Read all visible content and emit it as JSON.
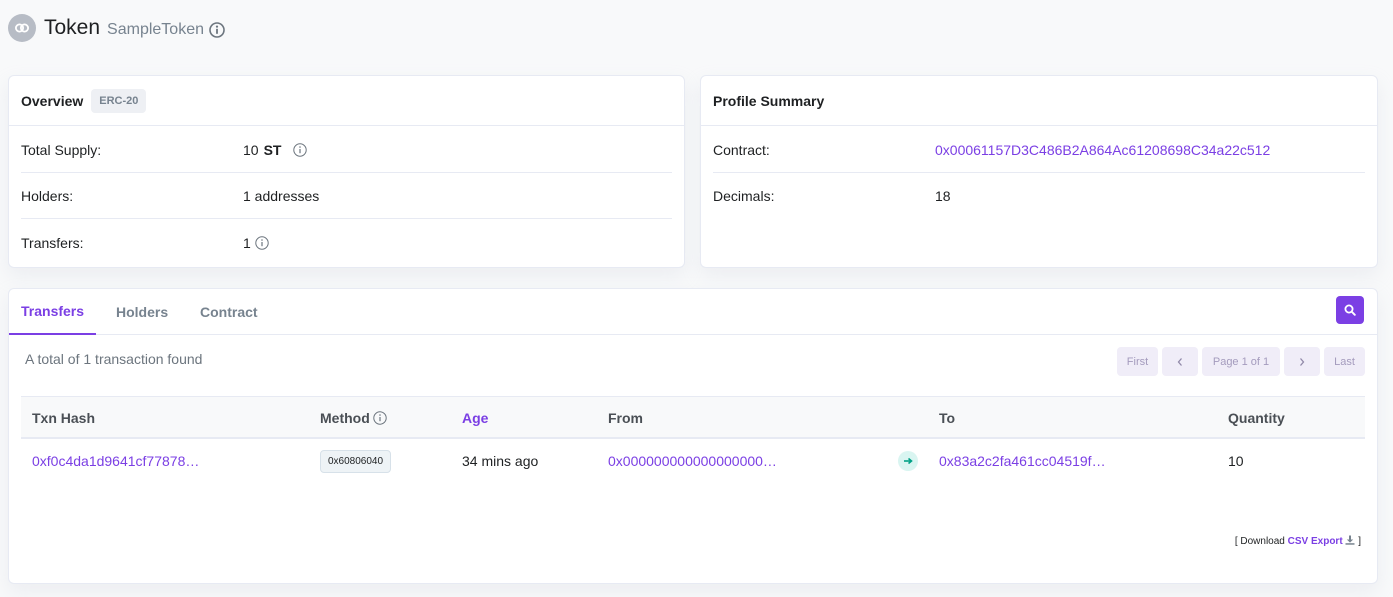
{
  "header": {
    "title": "Token",
    "subtitle": "SampleToken",
    "logo_icon": "link-icon",
    "info_icon": "info-circle-icon"
  },
  "overview": {
    "title": "Overview",
    "badge": "ERC-20",
    "rows": [
      {
        "label": "Total Supply:",
        "value": "10",
        "unit": "ST"
      },
      {
        "label": "Holders:",
        "value": "1 addresses"
      },
      {
        "label": "Transfers:",
        "value": "1"
      }
    ]
  },
  "profile": {
    "title": "Profile Summary",
    "rows": [
      {
        "label": "Contract:",
        "value": "0x00061157D3C486B2A864Ac61208698C34a22c512"
      },
      {
        "label": "Decimals:",
        "value": "18"
      }
    ]
  },
  "tabs": [
    {
      "label": "Transfers",
      "active": true
    },
    {
      "label": "Holders",
      "active": false
    },
    {
      "label": "Contract",
      "active": false
    }
  ],
  "transfers": {
    "summary": "A total of 1 transaction found",
    "pager": {
      "first": "First",
      "prev": "‹",
      "page": "Page 1 of 1",
      "next": "›",
      "last": "Last"
    },
    "columns": [
      "Txn Hash",
      "Method",
      "Age",
      "From",
      "To",
      "Quantity"
    ],
    "rows": [
      {
        "txn_hash": "0xf0c4da1d9641cf77878…",
        "method": "0x60806040",
        "age": "34 mins ago",
        "from": "0x000000000000000000…",
        "to": "0x83a2c2fa461cc04519f…",
        "quantity": "10"
      }
    ],
    "download": {
      "prefix": "[ Download",
      "link": "CSV Export",
      "suffix": "]"
    }
  },
  "colors": {
    "accent": "#7b3fe4",
    "text": "#1e2022",
    "muted": "#77838f",
    "border": "#e7eaf3"
  }
}
